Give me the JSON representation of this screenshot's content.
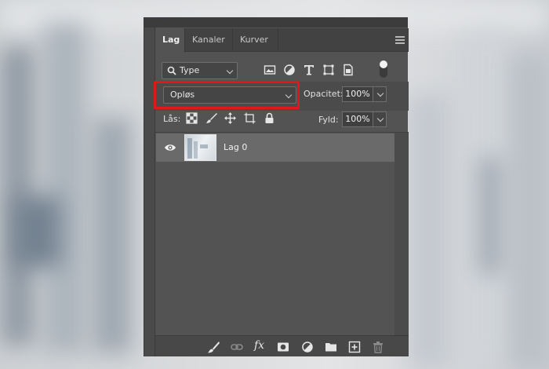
{
  "panel": {
    "tabs": [
      {
        "label": "Lag",
        "active": true
      },
      {
        "label": "Kanaler",
        "active": false
      },
      {
        "label": "Kurver",
        "active": false
      }
    ],
    "menu_icon": "panel-menu-icon"
  },
  "filter": {
    "kind_label": "Type",
    "icons": [
      "pixel-filter-icon",
      "adjustment-filter-icon",
      "type-filter-icon",
      "shape-filter-icon",
      "smart-object-filter-icon"
    ],
    "toggle_state": "on"
  },
  "blend": {
    "mode": "Opløs",
    "opacity_label": "Opacitet:",
    "opacity_value": "100%",
    "highlight_color": "#e0181a"
  },
  "lock": {
    "label": "Lås:",
    "icons": [
      "lock-transparent-icon",
      "lock-image-icon",
      "lock-position-icon",
      "lock-artboard-icon",
      "lock-all-icon"
    ],
    "fill_label": "Fyld:",
    "fill_value": "100%"
  },
  "layers": [
    {
      "name": "Lag 0",
      "visible": true,
      "selected": true
    }
  ],
  "bottom_icons": [
    "brush-icon",
    "link-icon",
    "fx-icon",
    "mask-icon",
    "adjustment-layer-icon",
    "folder-icon",
    "new-layer-icon",
    "trash-icon"
  ],
  "bottom_fx_label": "fx"
}
